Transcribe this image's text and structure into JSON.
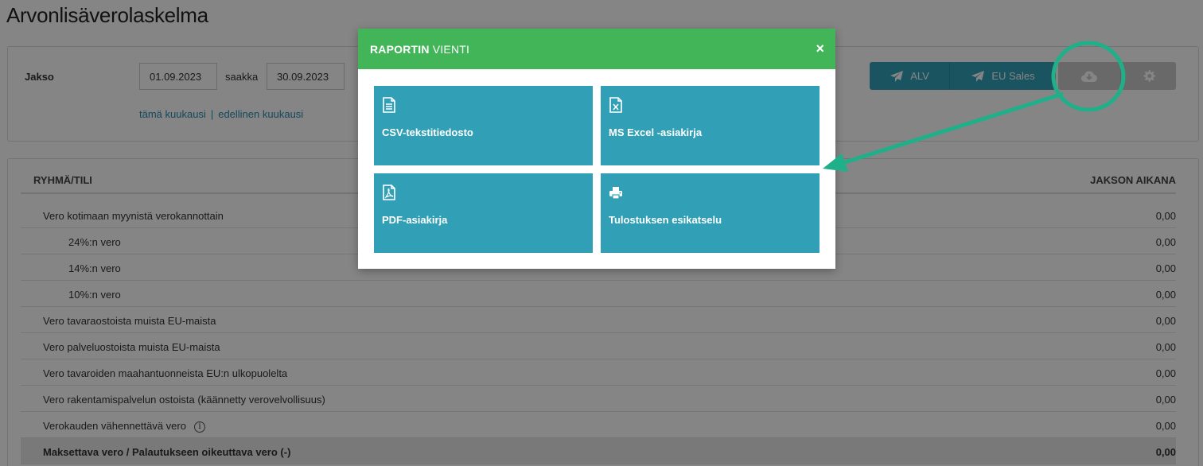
{
  "page": {
    "title": "Arvonlisäverolaskelma"
  },
  "filters": {
    "period_label": "Jakso",
    "start_date": "01.09.2023",
    "until_label": "saakka",
    "end_date": "30.09.2023",
    "link_this_month": "tämä kuukausi",
    "link_separator": "|",
    "link_previous_month": "edellinen kuukausi"
  },
  "toolbar": {
    "alv_label": "ALV",
    "eu_sales_label": "EU Sales",
    "download_icon": "cloud-download-icon",
    "settings_icon": "gear-icon"
  },
  "table": {
    "header_group": "RYHMÄ/TILI",
    "header_period": "JAKSON AIKANA",
    "rows": [
      {
        "label": "Vero kotimaan myynistä verokannottain",
        "value": "0,00"
      },
      {
        "label": "24%:n vero",
        "value": "0,00"
      },
      {
        "label": "14%:n vero",
        "value": "0,00"
      },
      {
        "label": "10%:n vero",
        "value": "0,00"
      },
      {
        "label": "Vero tavaraostoista muista EU-maista",
        "value": "0,00"
      },
      {
        "label": "Vero palveluostoista muista EU-maista",
        "value": "0,00"
      },
      {
        "label": "Vero tavaroiden maahantuonneista EU:n ulkopuolelta",
        "value": "0,00"
      },
      {
        "label": "Vero rakentamispalvelun ostoista (käännetty verovelvollisuus)",
        "value": "0,00"
      },
      {
        "label": "Verokauden vähennettävä vero",
        "value": "0,00"
      },
      {
        "label": "Maksettava vero / Palautukseen oikeuttava vero (-)",
        "value": "0,00"
      }
    ]
  },
  "modal": {
    "title_bold": "RAPORTIN",
    "title_rest": " VIENTI",
    "close": "×",
    "options": [
      {
        "label": "CSV-tekstitiedosto",
        "icon": "text-file-icon"
      },
      {
        "label": "MS Excel -asiakirja",
        "icon": "excel-file-icon"
      },
      {
        "label": "PDF-asiakirja",
        "icon": "pdf-file-icon"
      },
      {
        "label": "Tulostuksen esikatselu",
        "icon": "printer-icon"
      }
    ]
  },
  "colors": {
    "modal_header": "#41b558",
    "tile": "#31a0b6",
    "button_send": "#31a2b8",
    "annotation": "#1fb08a",
    "link": "#2a8bb0"
  }
}
